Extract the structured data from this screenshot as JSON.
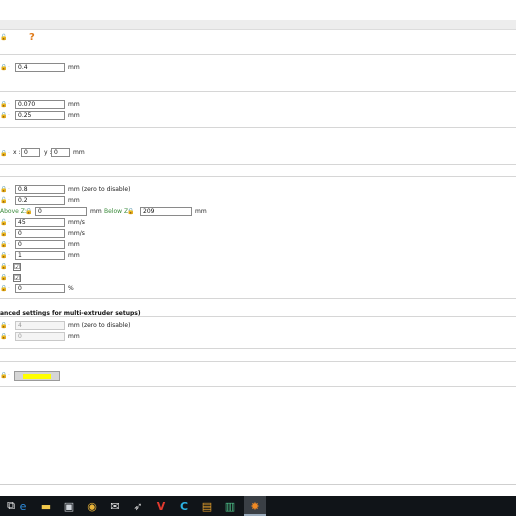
{
  "header": {
    "help_glyph": "?"
  },
  "section_a": {
    "value": "0.4",
    "unit": "mm"
  },
  "section_b": {
    "rows": [
      {
        "value": "0.070",
        "unit": "mm"
      },
      {
        "value": "0.25",
        "unit": "mm"
      }
    ]
  },
  "section_c": {
    "x_label": "x :",
    "x_value": "0",
    "y_label": "y :",
    "y_value": "0",
    "unit": "mm"
  },
  "section_d": {
    "row1": {
      "value": "0.8",
      "unit": "mm (zero to disable)"
    },
    "row2": {
      "value": "0.2",
      "unit": "mm"
    },
    "above_z": {
      "label": "Above Z:",
      "value": "0",
      "unit": "mm"
    },
    "below_z": {
      "label": "Below Z:",
      "value": "209",
      "unit": "mm"
    },
    "row4": {
      "value": "45",
      "unit": "mm/s"
    },
    "row5": {
      "value": "0",
      "unit": "mm/s"
    },
    "row6": {
      "value": "0",
      "unit": "mm"
    },
    "row7": {
      "value": "1",
      "unit": "mm"
    },
    "check1": "☑",
    "check2": "☑",
    "row10": {
      "value": "0",
      "unit": "%"
    }
  },
  "section_e": {
    "title": "anced settings for multi-extruder setups)",
    "row1": {
      "value": "4",
      "unit": "mm (zero to disable)"
    },
    "row2": {
      "value": "0",
      "unit": "mm"
    }
  },
  "section_f": {
    "swatch_color": "#ffff00"
  },
  "taskbar": {
    "items": [
      {
        "name": "task-view-icon",
        "glyph": "⧉"
      },
      {
        "name": "edge-icon",
        "glyph": "e"
      },
      {
        "name": "file-explorer-icon",
        "glyph": "▬"
      },
      {
        "name": "store-icon",
        "glyph": "▣"
      },
      {
        "name": "chrome-icon",
        "glyph": "◉"
      },
      {
        "name": "app-icon-1",
        "glyph": "✉"
      },
      {
        "name": "app-icon-2",
        "glyph": "➶"
      },
      {
        "name": "app-icon-3",
        "glyph": "V"
      },
      {
        "name": "app-icon-4",
        "glyph": "C"
      },
      {
        "name": "app-icon-5",
        "glyph": "▤"
      },
      {
        "name": "app-icon-6",
        "glyph": "▥"
      },
      {
        "name": "prusa-slicer-icon",
        "glyph": "✸"
      }
    ]
  }
}
